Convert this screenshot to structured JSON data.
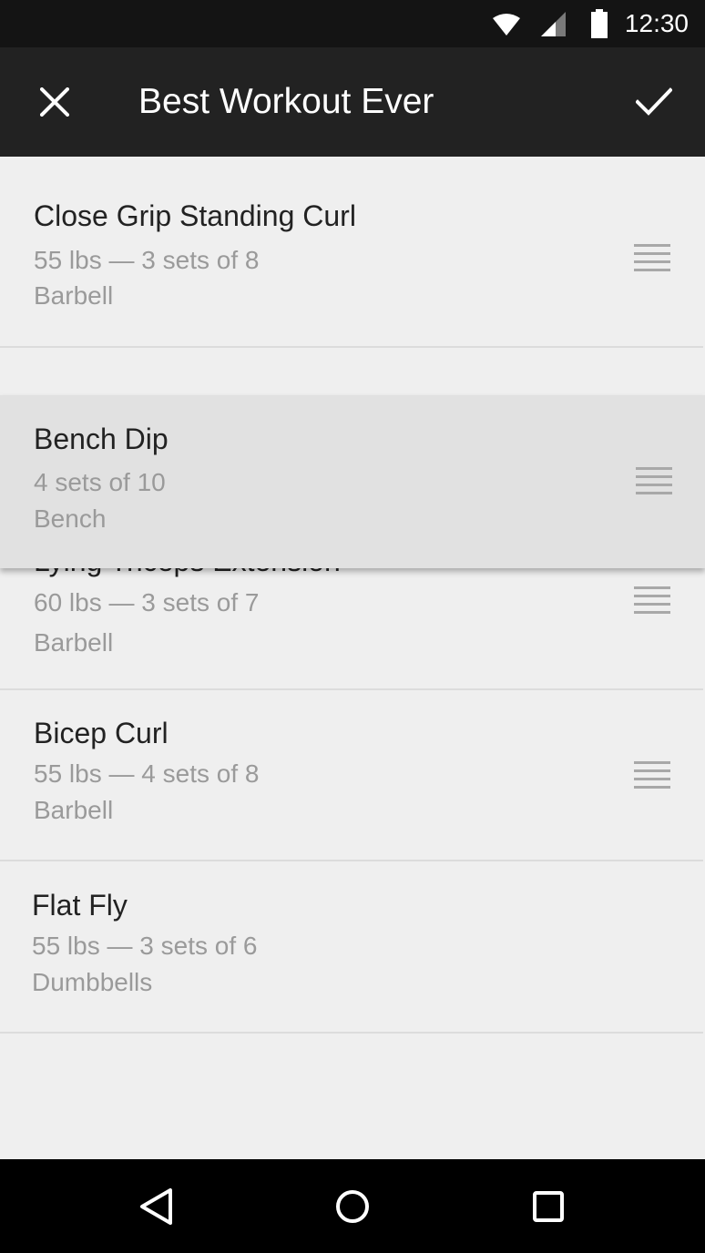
{
  "status_bar": {
    "time": "12:30",
    "icons": [
      "wifi-icon",
      "cell-signal-icon",
      "battery-icon"
    ]
  },
  "toolbar": {
    "title": "Best Workout Ever",
    "close_icon": "close-icon",
    "done_icon": "checkmark-icon"
  },
  "exercises": [
    {
      "name": "Close Grip Standing Curl",
      "detail": "55 lbs — 3 sets of 8",
      "equipment": "Barbell"
    },
    {
      "name": "Lying Triceps Extension",
      "detail": "60 lbs  — 3 sets of 7",
      "equipment": "Barbell"
    },
    {
      "name": "Bicep Curl",
      "detail": "55 lbs —  4 sets of 8",
      "equipment": "Barbell"
    },
    {
      "name": "Flat Fly",
      "detail": "55 lbs —  3 sets of 6",
      "equipment": "Dumbbells"
    }
  ],
  "dragged_exercise": {
    "name": "Bench Dip",
    "detail": "4 sets of 10",
    "equipment": "Bench"
  },
  "nav_bar": {
    "icons": [
      "back-icon",
      "home-icon",
      "recents-icon"
    ]
  },
  "colors": {
    "status_bar": "#141414",
    "toolbar": "#222222",
    "list_background": "#efefef",
    "dragged_row": "#e1e1e1",
    "nav_bar": "#000000"
  }
}
